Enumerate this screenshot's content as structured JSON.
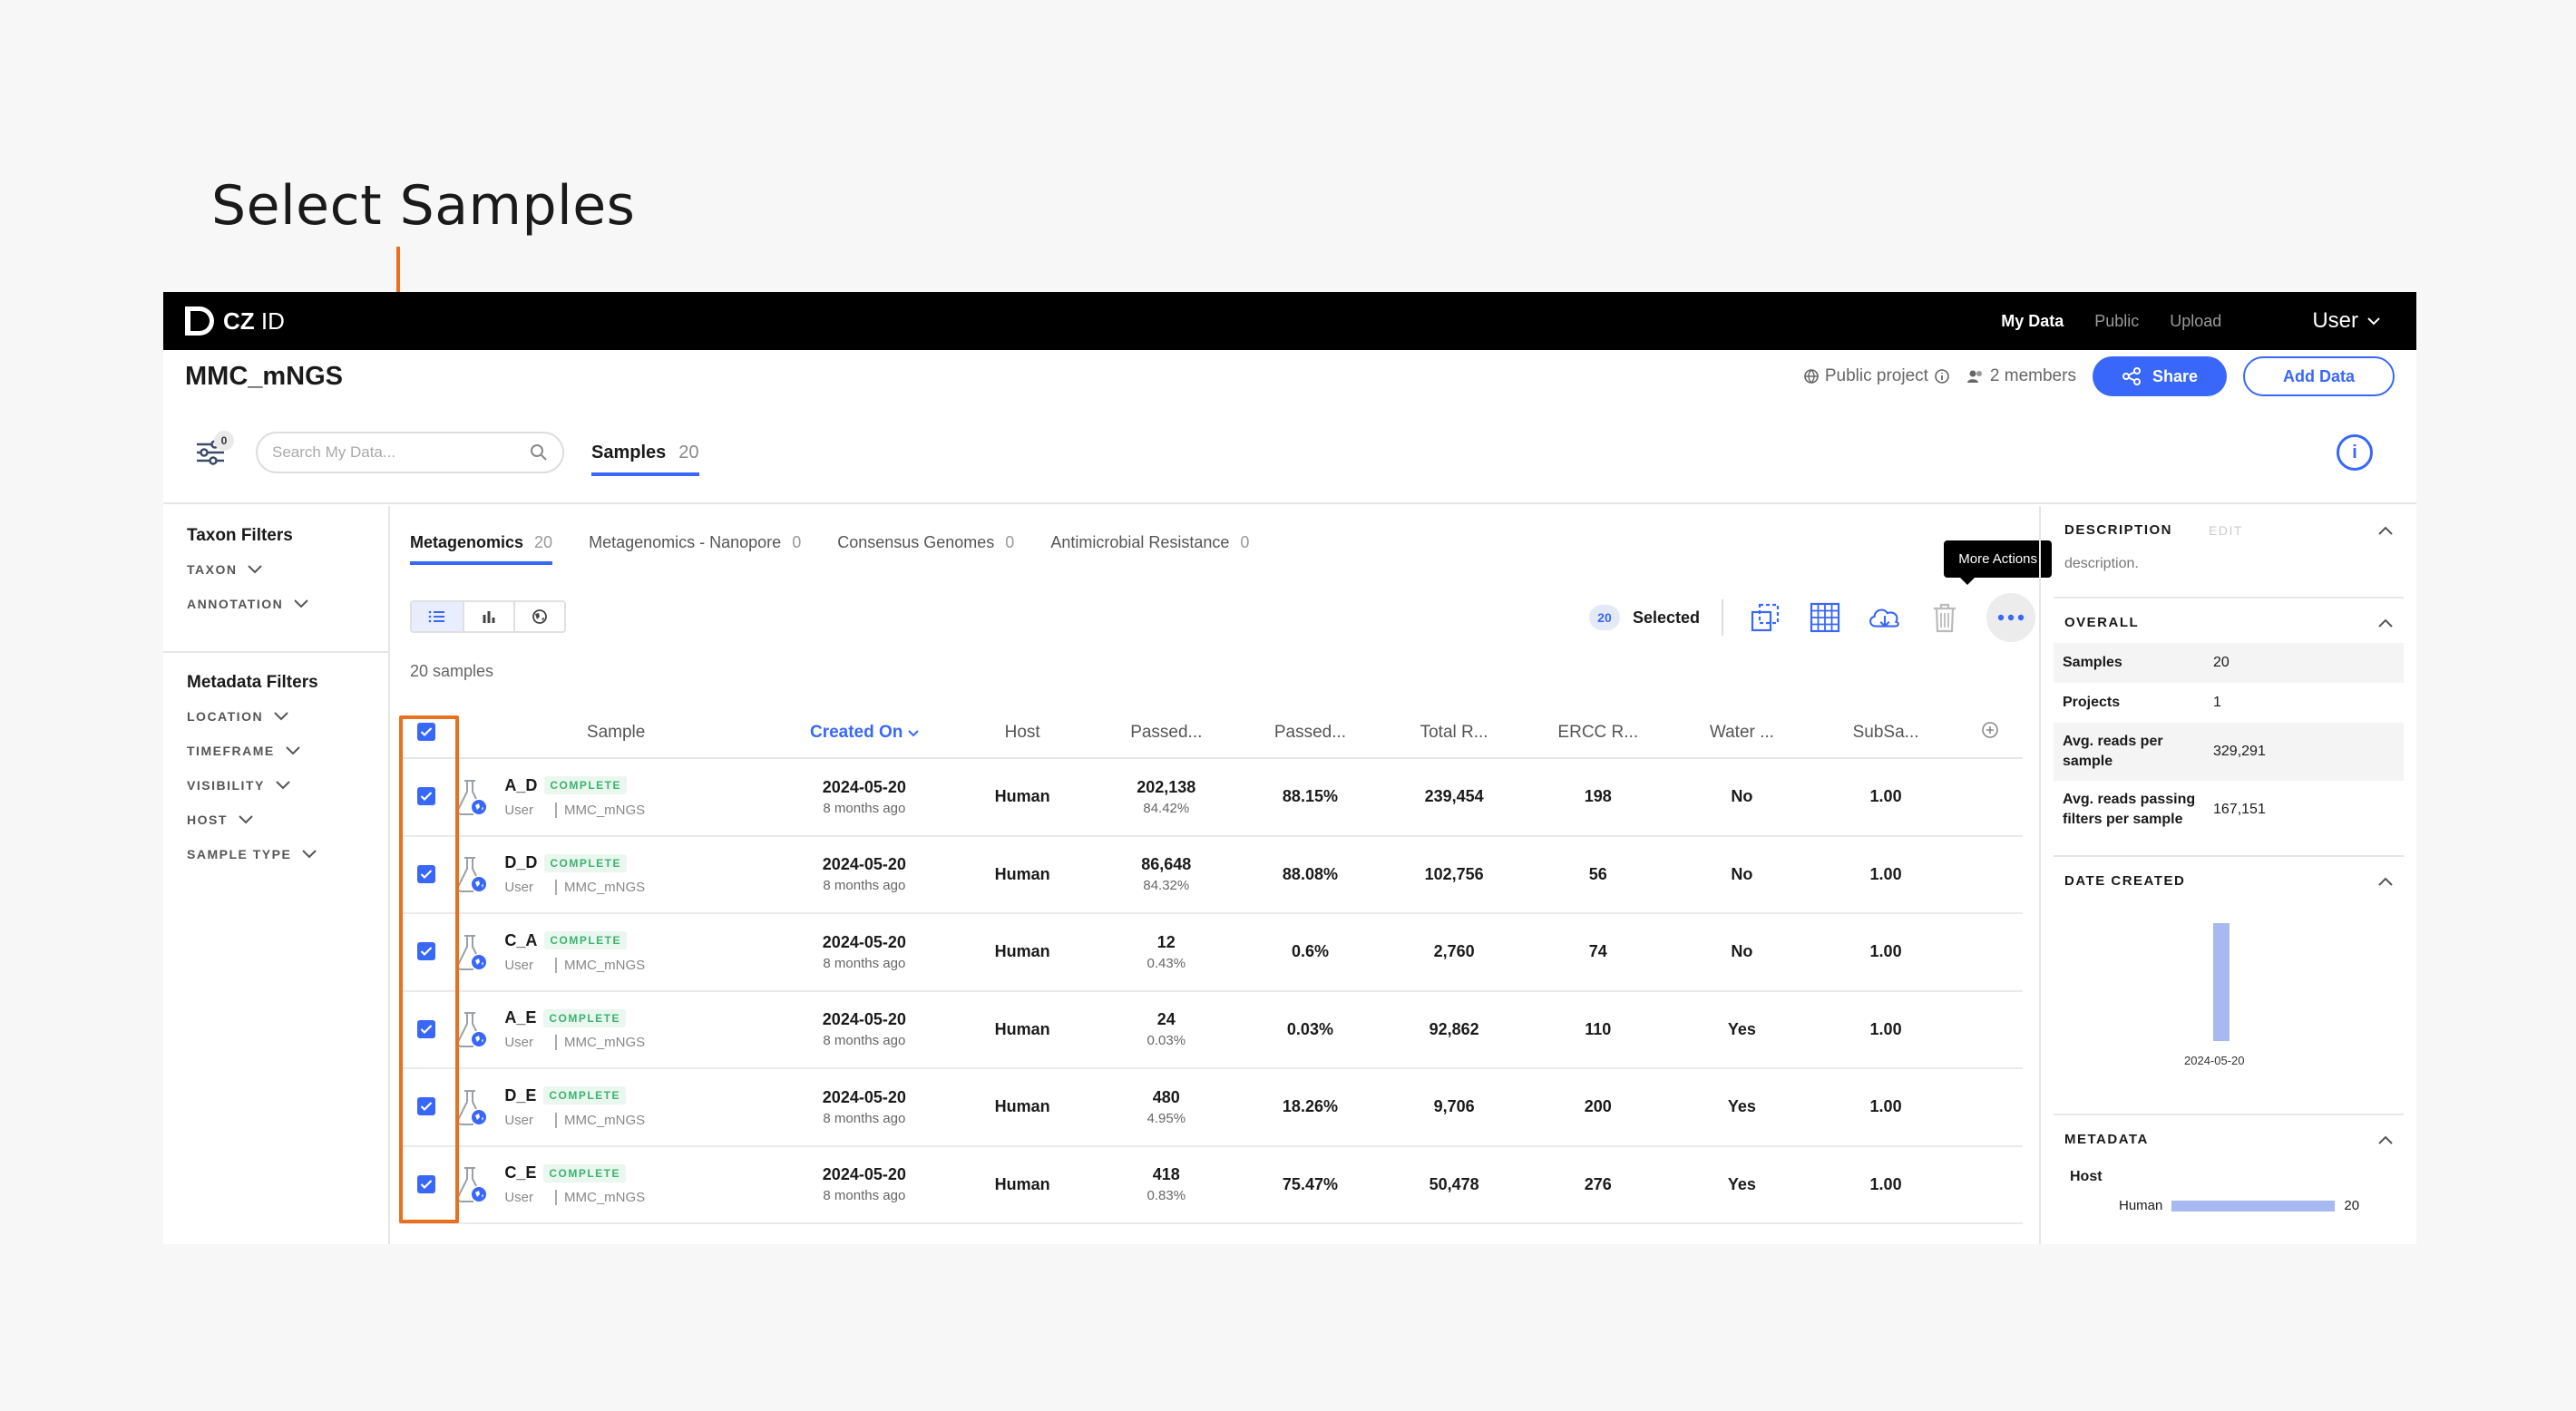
{
  "annotation": {
    "title": "Select Samples"
  },
  "topbar": {
    "logo_bold": "CZ",
    "logo_light": "ID",
    "nav": [
      "My Data",
      "Public",
      "Upload"
    ],
    "user": "User"
  },
  "project": {
    "title": "MMC_mNGS",
    "visibility": "Public project",
    "members": "2 members",
    "share_label": "Share",
    "add_data_label": "Add Data"
  },
  "toolbar": {
    "filter_count": "0",
    "search_placeholder": "Search My Data...",
    "samples_tab": "Samples",
    "samples_tab_count": "20"
  },
  "left_filters": {
    "taxon_title": "Taxon Filters",
    "taxon_items": [
      "TAXON",
      "ANNOTATION"
    ],
    "metadata_title": "Metadata Filters",
    "metadata_items": [
      "LOCATION",
      "TIMEFRAME",
      "VISIBILITY",
      "HOST",
      "SAMPLE TYPE"
    ]
  },
  "subtabs": [
    {
      "label": "Metagenomics",
      "count": "20"
    },
    {
      "label": "Metagenomics - Nanopore",
      "count": "0"
    },
    {
      "label": "Consensus Genomes",
      "count": "0"
    },
    {
      "label": "Antimicrobial Resistance",
      "count": "0"
    }
  ],
  "actions": {
    "selected_count": "20",
    "selected_label": "Selected",
    "tooltip": "More Actions"
  },
  "sample_count_label": "20 samples",
  "table": {
    "headers": [
      "Sample",
      "Created On",
      "Host",
      "Passed...",
      "Passed...",
      "Total R...",
      "ERCC R...",
      "Water ...",
      "SubSa..."
    ],
    "rows": [
      {
        "name": "A_D",
        "status": "COMPLETE",
        "user": "User",
        "project": "MMC_mNGS",
        "date": "2024-05-20",
        "ago": "8 months ago",
        "host": "Human",
        "passed": "202,138",
        "passed_pct": "84.42%",
        "passed2": "88.15%",
        "total": "239,454",
        "ercc": "198",
        "water": "No",
        "subsample": "1.00"
      },
      {
        "name": "D_D",
        "status": "COMPLETE",
        "user": "User",
        "project": "MMC_mNGS",
        "date": "2024-05-20",
        "ago": "8 months ago",
        "host": "Human",
        "passed": "86,648",
        "passed_pct": "84.32%",
        "passed2": "88.08%",
        "total": "102,756",
        "ercc": "56",
        "water": "No",
        "subsample": "1.00"
      },
      {
        "name": "C_A",
        "status": "COMPLETE",
        "user": "User",
        "project": "MMC_mNGS",
        "date": "2024-05-20",
        "ago": "8 months ago",
        "host": "Human",
        "passed": "12",
        "passed_pct": "0.43%",
        "passed2": "0.6%",
        "total": "2,760",
        "ercc": "74",
        "water": "No",
        "subsample": "1.00"
      },
      {
        "name": "A_E",
        "status": "COMPLETE",
        "user": "User",
        "project": "MMC_mNGS",
        "date": "2024-05-20",
        "ago": "8 months ago",
        "host": "Human",
        "passed": "24",
        "passed_pct": "0.03%",
        "passed2": "0.03%",
        "total": "92,862",
        "ercc": "110",
        "water": "Yes",
        "subsample": "1.00"
      },
      {
        "name": "D_E",
        "status": "COMPLETE",
        "user": "User",
        "project": "MMC_mNGS",
        "date": "2024-05-20",
        "ago": "8 months ago",
        "host": "Human",
        "passed": "480",
        "passed_pct": "4.95%",
        "passed2": "18.26%",
        "total": "9,706",
        "ercc": "200",
        "water": "Yes",
        "subsample": "1.00"
      },
      {
        "name": "C_E",
        "status": "COMPLETE",
        "user": "User",
        "project": "MMC_mNGS",
        "date": "2024-05-20",
        "ago": "8 months ago",
        "host": "Human",
        "passed": "418",
        "passed_pct": "0.83%",
        "passed2": "75.47%",
        "total": "50,478",
        "ercc": "276",
        "water": "Yes",
        "subsample": "1.00"
      }
    ]
  },
  "right_panel": {
    "description_title": "DESCRIPTION",
    "edit_label": "EDIT",
    "description_text": "description.",
    "overall_title": "OVERALL",
    "overall": [
      {
        "key": "Samples",
        "value": "20"
      },
      {
        "key": "Projects",
        "value": "1"
      },
      {
        "key": "Avg. reads per sample",
        "value": "329,291"
      },
      {
        "key": "Avg. reads passing filters per sample",
        "value": "167,151"
      }
    ],
    "date_created_title": "DATE CREATED",
    "date_bar_label": "2024-05-20",
    "metadata_title": "METADATA",
    "metadata_host_label": "Host",
    "metadata_host_value": "Human",
    "metadata_host_count": "20"
  },
  "colors": {
    "accent": "#3867fa",
    "annotation": "#e8701e",
    "complete": "#3cb371"
  }
}
